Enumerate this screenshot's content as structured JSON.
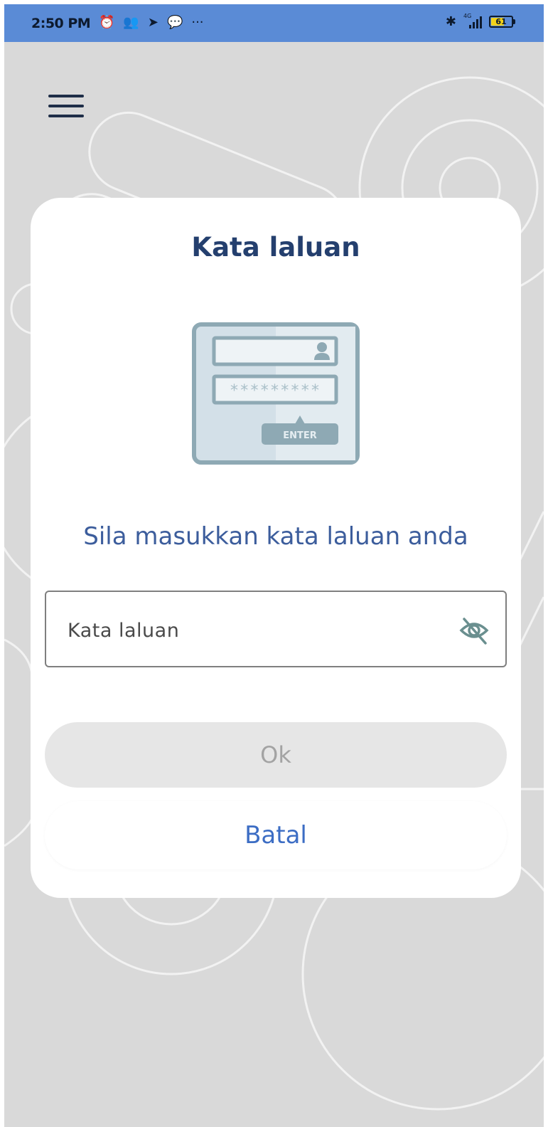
{
  "status_bar": {
    "time": "2:50 PM",
    "notification_icons": [
      "alarm-icon",
      "group-icon",
      "telegram-icon",
      "chat-icon",
      "more-icon"
    ],
    "network_label": "4G",
    "battery_level": "61"
  },
  "dialog": {
    "title": "Kata laluan",
    "illustration": {
      "password_mask": "*********",
      "enter_label": "ENTER"
    },
    "message": "Sila masukkan kata laluan anda",
    "password_field": {
      "placeholder": "Kata laluan",
      "value": ""
    },
    "ok_label": "Ok",
    "cancel_label": "Batal"
  },
  "colors": {
    "status_bar": "#5a8bd6",
    "background": "#d9d9d9",
    "title": "#243f6e",
    "message": "#3c5d9c",
    "cancel": "#3c6dc4",
    "ok_disabled_bg": "#e6e6e6",
    "ok_disabled_text": "#a3a3a3"
  }
}
